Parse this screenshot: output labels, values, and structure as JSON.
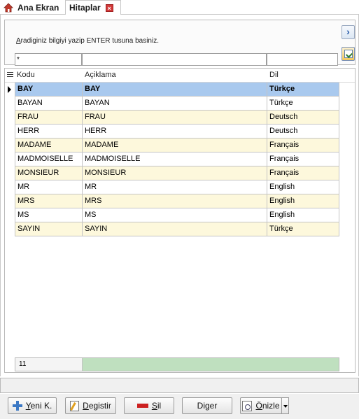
{
  "tabs": [
    {
      "label": "Ana Ekran",
      "icon": "home-icon"
    },
    {
      "label": "Hitaplar",
      "icon": "close-icon"
    }
  ],
  "search": {
    "hint_prefix": "A",
    "hint_rest": "radiginiz bilgiyi yazip ENTER tusuna basiniz.",
    "filter_code": "*",
    "filter_desc": "",
    "filter_lang": ""
  },
  "grid": {
    "columns": [
      "Kodu",
      "Açiklama",
      "Dil"
    ],
    "rows": [
      {
        "code": "BAY",
        "desc": "BAY",
        "lang": "Türkçe",
        "selected": true
      },
      {
        "code": "BAYAN",
        "desc": "BAYAN",
        "lang": "Türkçe"
      },
      {
        "code": "FRAU",
        "desc": "FRAU",
        "lang": "Deutsch"
      },
      {
        "code": "HERR",
        "desc": "HERR",
        "lang": "Deutsch"
      },
      {
        "code": "MADAME",
        "desc": "MADAME",
        "lang": "Français"
      },
      {
        "code": "MADMOISELLE",
        "desc": "MADMOISELLE",
        "lang": "Français"
      },
      {
        "code": "MONSIEUR",
        "desc": "MONSIEUR",
        "lang": "Français"
      },
      {
        "code": "MR",
        "desc": "MR",
        "lang": "English"
      },
      {
        "code": "MRS",
        "desc": "MRS",
        "lang": "English"
      },
      {
        "code": "MS",
        "desc": "MS",
        "lang": "English"
      },
      {
        "code": "SAYIN",
        "desc": "SAYIN",
        "lang": "Türkçe"
      }
    ],
    "record_count": "11"
  },
  "buttons": {
    "new_prefix": "Y",
    "new_rest": "eni K.",
    "edit_prefix": "D",
    "edit_rest": "egistir",
    "delete_prefix": "S",
    "delete_rest": "il",
    "other": "Diger",
    "preview_prefix": "Ö",
    "preview_rest": "nizle"
  },
  "colors": {
    "row_alt": "#fdf8dc",
    "row_selected": "#a9c9ee",
    "footer_agg": "#bfe0bf"
  }
}
